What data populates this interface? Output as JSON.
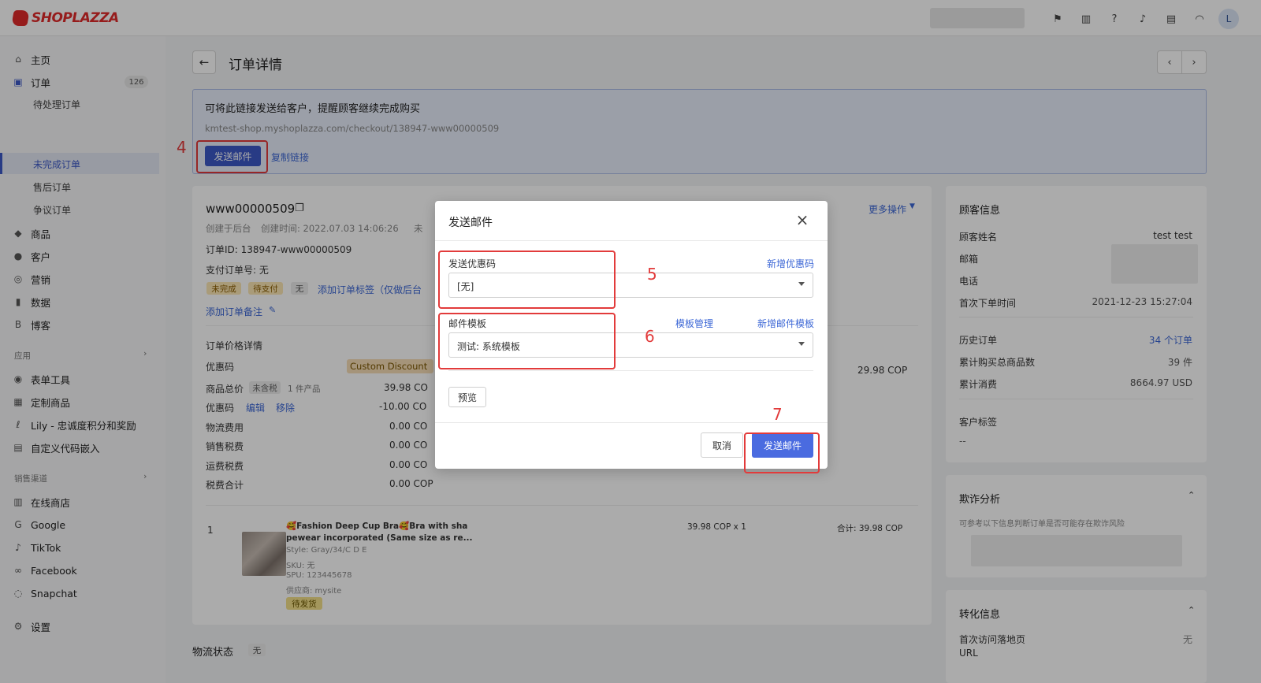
{
  "app": {
    "logo_text": "SHOPLAZZA",
    "avatar_letter": "L"
  },
  "topbar": {
    "icons": [
      "flag-icon",
      "store-icon",
      "help-icon",
      "bell-icon",
      "chat-icon",
      "wifi-icon"
    ]
  },
  "sidebar": {
    "home": "主页",
    "orders": "订单",
    "orders_count": "126",
    "orders_sub": [
      "待处理订单",
      "未完成订单",
      "售后订单",
      "争议订单"
    ],
    "products": "商品",
    "customers": "客户",
    "marketing": "营销",
    "data": "数据",
    "blog": "博客",
    "apps_group": "应用",
    "apps": [
      "表单工具",
      "定制商品",
      "Lily - 忠诚度积分和奖励",
      "自定义代码嵌入"
    ],
    "channels_group": "销售渠道",
    "channels": [
      "在线商店",
      "Google",
      "TikTok",
      "Facebook",
      "Snapchat"
    ],
    "settings": "设置"
  },
  "page": {
    "title": "订单详情"
  },
  "banner": {
    "title": "可将此链接发送给客户，提醒顾客继续完成购买",
    "link": "kmtest-shop.myshoplazza.com/checkout/138947-www00000509",
    "send_email": "发送邮件",
    "copy_link": "复制链接"
  },
  "order": {
    "number": "www00000509",
    "meta_created_from": "创建于后台",
    "meta_created_time": "创建时间:  2022.07.03 14:06:26",
    "meta_cut": "未",
    "order_id": "订单ID: 138947-www00000509",
    "payment_no": "支付订单号: 无",
    "tags": [
      "未完成",
      "待支付",
      "无"
    ],
    "add_tag": "添加订单标签（仅做后台",
    "add_note": "添加订单备注",
    "more_actions": "更多操作",
    "price_title": "订单价格详情",
    "discount_code_label": "优惠码",
    "discount_code_value": "Custom Discount",
    "subtotal_label": "商品总价",
    "subtotal_tax_tag": "未含税",
    "subtotal_count": "1 件产品",
    "subtotal_value": "39.98 CO",
    "discount_label": "优惠码",
    "discount_edit": "编辑",
    "discount_remove": "移除",
    "discount_value": "-10.00 CO",
    "shipping_label": "物流费用",
    "shipping_value": "0.00 CO",
    "sales_tax_label": "销售税费",
    "sales_tax_value": "0.00 CO",
    "ship_tax_label": "运费税费",
    "ship_tax_value": "0.00 CO",
    "tax_total_label": "税费合计",
    "tax_total_value": "0.00 COP",
    "total_right": "29.98 COP",
    "item_index": "1",
    "item_name_1": "🥰Fashion Deep Cup Bra🥰Bra with sha",
    "item_name_2": "pewear incorporated (Same size as re...",
    "item_style": "Style: Gray/34/C D E",
    "item_sku": "SKU: 无",
    "item_spu": "SPU: 123445678",
    "item_vendor": "供应商: mysite",
    "item_status": "待发货",
    "item_price": "39.98 COP x 1",
    "item_total": "合计:  39.98 COP",
    "logistics_title": "物流状态",
    "logistics_tag": "无"
  },
  "customer": {
    "title": "顾客信息",
    "name_label": "顾客姓名",
    "name_value": "test test",
    "email_label": "邮箱",
    "phone_label": "电话",
    "first_order_label": "首次下单时间",
    "first_order_value": "2021-12-23 15:27:04",
    "history_label": "历史订单",
    "history_value": "34 个订单",
    "total_items_label": "累计购买总商品数",
    "total_items_value": "39 件",
    "total_spend_label": "累计消费",
    "total_spend_value": "8664.97 USD",
    "tags_label": "客户标签",
    "tags_value": "--"
  },
  "fraud": {
    "title": "欺诈分析",
    "desc": "可参考以下信息判断订单是否可能存在欺诈风险"
  },
  "conversion": {
    "title": "转化信息",
    "first_visit_label": "首次访问落地页",
    "first_visit_label_2": "URL",
    "first_visit_value": "无"
  },
  "modal": {
    "title": "发送邮件",
    "discount_label": "发送优惠码",
    "discount_add": "新增优惠码",
    "discount_value": "[无]",
    "template_label": "邮件模板",
    "template_manage": "模板管理",
    "template_add": "新增邮件模板",
    "template_value": "测试: 系统模板",
    "preview": "预览",
    "cancel": "取消",
    "send": "发送邮件"
  },
  "steps": [
    "4",
    "5",
    "6",
    "7"
  ],
  "colors": {
    "primary": "#3c59c6",
    "highlight": "#e23b3b",
    "link": "#3c67d6"
  }
}
